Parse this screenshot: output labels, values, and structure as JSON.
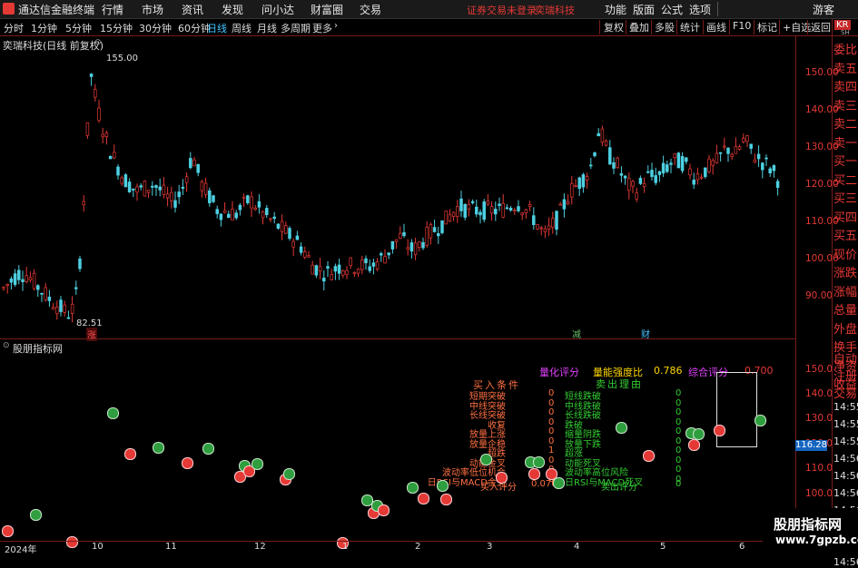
{
  "menubar": {
    "app_title": "通达信金融终端",
    "items": [
      "行情",
      "市场",
      "资讯",
      "发现",
      "问小达",
      "财富圈",
      "交易"
    ],
    "notice": "证券交易未登录",
    "stock_name": "奕瑞科技",
    "right_items": [
      "功能",
      "版面",
      "公式",
      "选项"
    ],
    "user": "游客"
  },
  "periodbar": {
    "periods": [
      "分时",
      "1分钟",
      "5分钟",
      "15分钟",
      "30分钟",
      "60分钟",
      "日线",
      "周线",
      "月线",
      "多周期",
      "更多"
    ],
    "more_icon": "chevron-right-icon",
    "right_buttons": [
      "复权",
      "叠加",
      "多股",
      "统计",
      "画线",
      "F10",
      "标记",
      "+自选",
      "返回"
    ]
  },
  "kpanel": {
    "title": "奕瑞科技(日线 前复权)",
    "max_label": "155.00",
    "min_label": "82.51",
    "y_axis": [
      "150.00",
      "140.00",
      "130.00",
      "120.00",
      "110.00",
      "100.00",
      "90.00"
    ],
    "markers": {
      "zhang": "涨",
      "jian": "减",
      "cai": "财"
    }
  },
  "indicator": {
    "title": "股朋指标网",
    "y_axis": [
      "150.0",
      "140.0",
      "130.0",
      "120.0",
      "110.0",
      "100.0"
    ],
    "current_value": "116.28",
    "quant_score_label": "量化评分",
    "strength_label": "量能强度比",
    "strength_value": "0.786",
    "composite_label": "综合评分",
    "composite_value": "0.700",
    "sell_reason_title": "卖出理由",
    "buy_cond_title": "买入条件",
    "buy_rows": [
      {
        "label": "短期突破",
        "value": "0"
      },
      {
        "label": "中线突破",
        "value": "0"
      },
      {
        "label": "长线突破",
        "value": "0"
      },
      {
        "label": "收复",
        "value": "0"
      },
      {
        "label": "放量上涨",
        "value": "0"
      },
      {
        "label": "放量企稳",
        "value": "0"
      },
      {
        "label": "超跌",
        "value": "1"
      },
      {
        "label": "动能金叉",
        "value": "0"
      },
      {
        "label": "波动率低位机会",
        "value": "0"
      },
      {
        "label": "日RSI与MACD金叉",
        "value": "0"
      }
    ],
    "buy_score_label": "买入评分",
    "buy_score_value": "0.070",
    "sell_rows": [
      {
        "label": "短线跌破",
        "value": "0"
      },
      {
        "label": "中线跌破",
        "value": "0"
      },
      {
        "label": "长线跌破",
        "value": "0"
      },
      {
        "label": "跌破",
        "value": "0"
      },
      {
        "label": "缩量阴跌",
        "value": "0"
      },
      {
        "label": "放量下跌",
        "value": "0"
      },
      {
        "label": "超涨",
        "value": "0"
      },
      {
        "label": "动能死叉",
        "value": "0"
      },
      {
        "label": "波动率高位风险",
        "value": "0"
      },
      {
        "label": "日RSI与MACD死叉",
        "value": "0"
      }
    ],
    "sell_score_label": "卖出评分"
  },
  "xaxis": {
    "labels": [
      "2024年",
      "10",
      "11",
      "12",
      "1",
      "2",
      "3",
      "4",
      "5",
      "6"
    ]
  },
  "rightpanel": {
    "header_code": "KR",
    "header_sub": "SH",
    "items": [
      "委比",
      "卖五",
      "卖四",
      "卖三",
      "卖二",
      "卖一",
      "买一",
      "买二",
      "买三",
      "买四",
      "买五",
      "现价",
      "涨跌",
      "涨幅",
      "总量",
      "外盘",
      "换手",
      "净资",
      "收益"
    ],
    "lower_items": [
      "自动",
      "注册",
      "交易",
      "14:55",
      "14:55",
      "14:55",
      "14:56",
      "14:56",
      "14:56",
      "14:56",
      "14:56",
      "14:56",
      "14:56"
    ]
  },
  "watermark": {
    "title": "股朋指标网",
    "url": "www.7gpzb.com"
  },
  "colors": {
    "up": "#e53935",
    "down": "#4dd0e1",
    "frame": "#7a1b1b",
    "badge_buy": "#e53935",
    "badge_sell": "#2e9e3e"
  }
}
